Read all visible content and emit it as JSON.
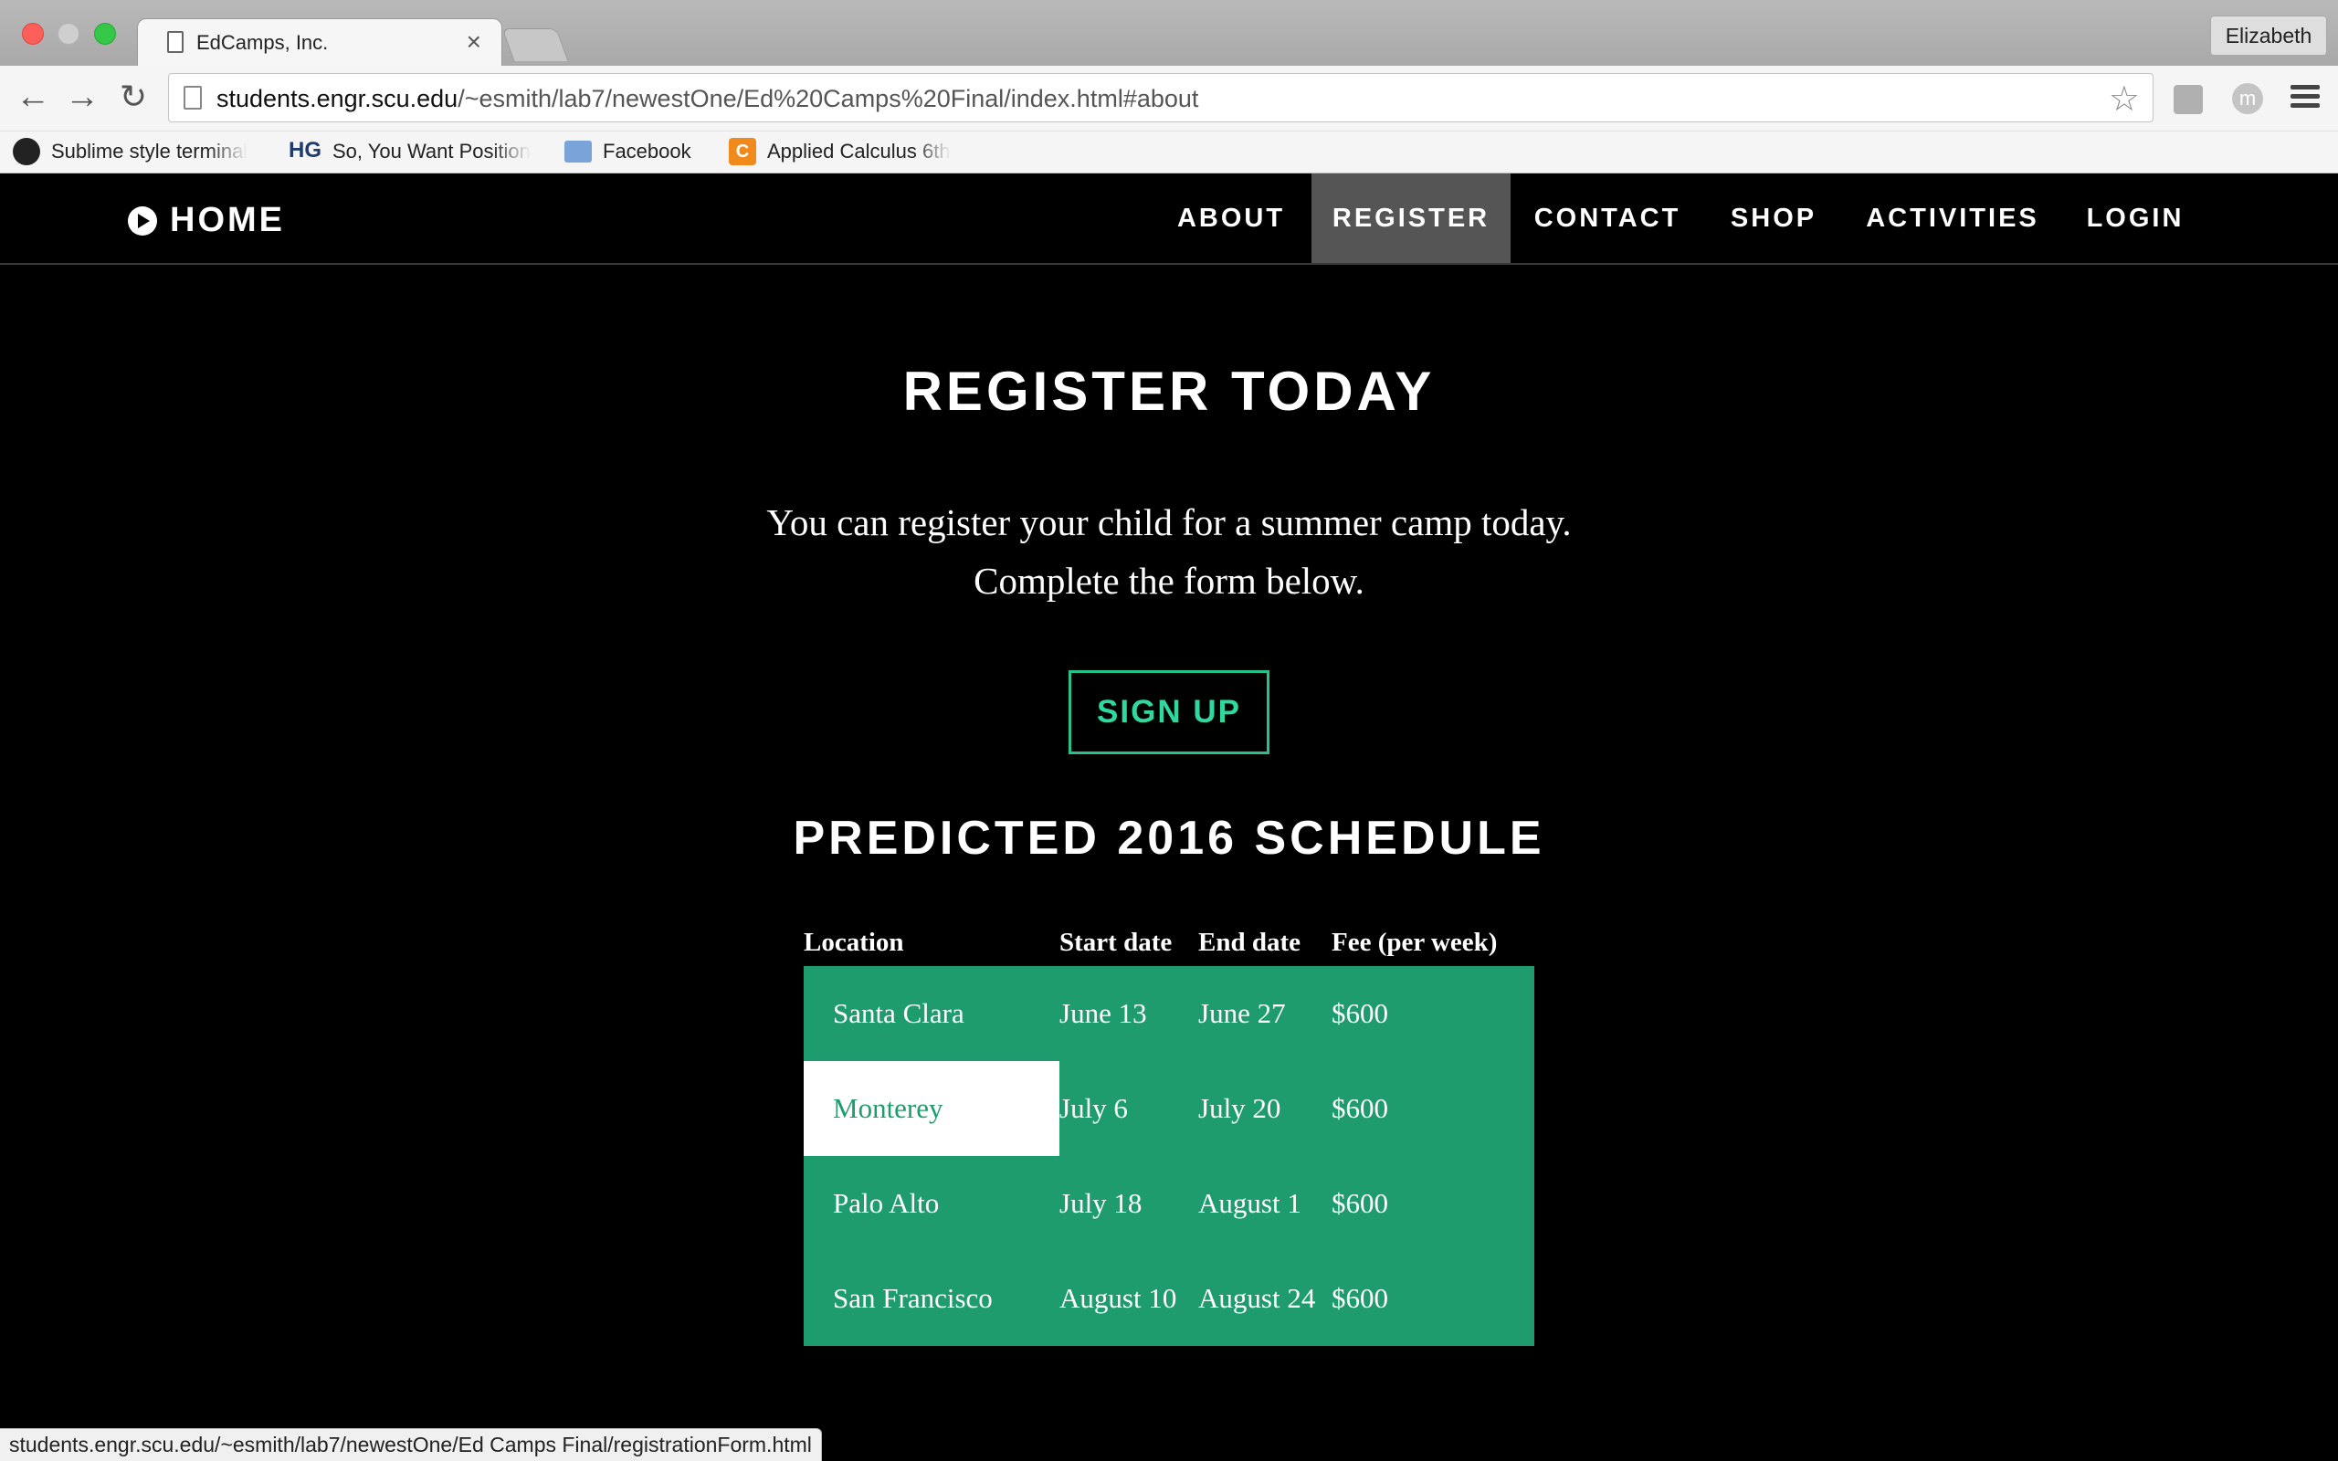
{
  "browser": {
    "tab_title": "EdCamps, Inc.",
    "tab_close": "×",
    "profile_name": "Elizabeth",
    "url_host": "students.engr.scu.edu",
    "url_path": "/~esmith/lab7/newestOne/Ed%20Camps%20Final/index.html#about",
    "bookmarks": [
      {
        "label": "Sublime style terminal",
        "icon": "github-icon"
      },
      {
        "label": "So, You Want Position",
        "icon": "hg-icon"
      },
      {
        "label": "Facebook",
        "icon": "folder-icon"
      },
      {
        "label": "Applied Calculus 6th",
        "icon": "c-icon"
      }
    ],
    "hg_glyph": "HG",
    "c_glyph": "C",
    "ext_glyph": "m",
    "status_url": "students.engr.scu.edu/~esmith/lab7/newestOne/Ed Camps Final/registrationForm.html"
  },
  "site": {
    "home_label": "HOME",
    "nav": {
      "about": "ABOUT",
      "register": "REGISTER",
      "contact": "CONTACT",
      "shop": "SHOP",
      "activities": "ACTIVITIES",
      "login": "LOGIN"
    },
    "active_nav": "register"
  },
  "main": {
    "title": "REGISTER TODAY",
    "intro_line1": "You can register your child for a summer camp today.",
    "intro_line2": "Complete the form below.",
    "signup_label": "SIGN UP",
    "schedule_title": "PREDICTED 2016 SCHEDULE",
    "accent_color": "#1f9c6d",
    "table": {
      "headers": [
        "Location",
        "Start date",
        "End date",
        "Fee (per week)"
      ],
      "rows": [
        [
          "Santa Clara",
          "June 13",
          "June 27",
          "$600"
        ],
        [
          "Monterey",
          "July 6",
          "July 20",
          "$600"
        ],
        [
          "Palo Alto",
          "July 18",
          "August 1",
          "$600"
        ],
        [
          "San Francisco",
          "August 10",
          "August 24",
          "$600"
        ]
      ],
      "hovered_row": 1
    }
  }
}
